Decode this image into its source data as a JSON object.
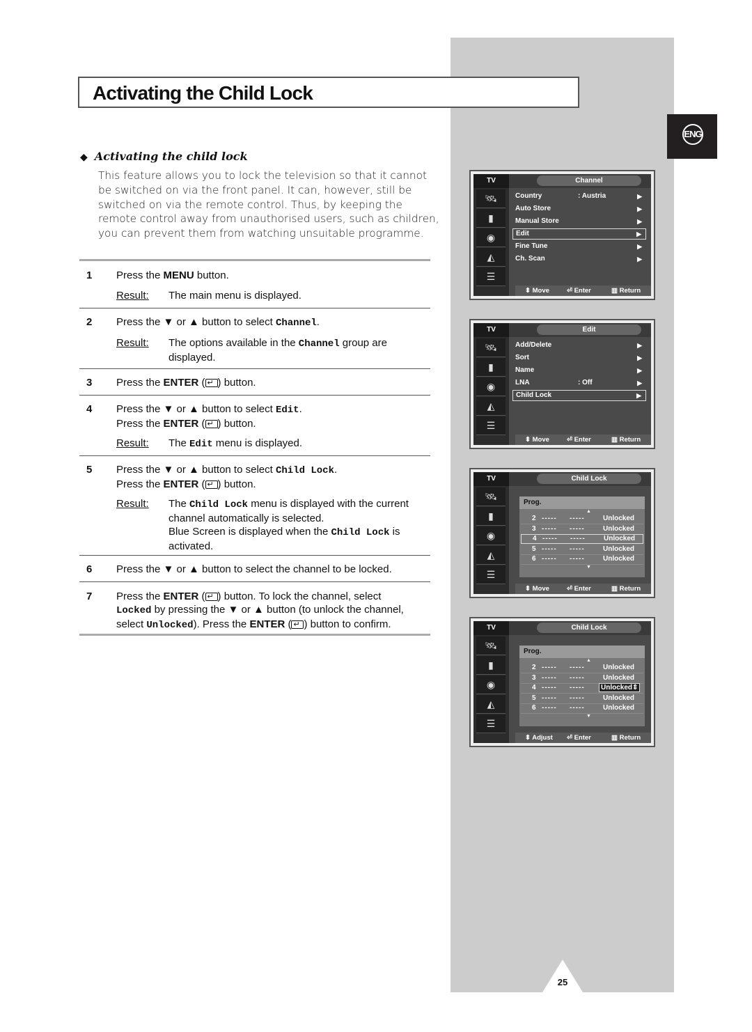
{
  "page": {
    "title": "Activating the Child Lock",
    "language_tab": "ENG",
    "page_number": "25"
  },
  "section": {
    "heading": "Activating the child lock",
    "intro": "This feature allows you to lock the television so that it cannot be switched on via the front panel. It can, however, still be switched on via the remote control. Thus, by keeping the remote control away from unauthorised users, such as children, you can prevent them from watching unsuitable programme."
  },
  "steps": [
    {
      "num": "1",
      "lines": [
        "Press the |MENU| button."
      ],
      "result_label": "Result:",
      "result": "The main menu is displayed."
    },
    {
      "num": "2",
      "lines": [
        "Press the ▼ or ▲ button to select {Channel}."
      ],
      "result_label": "Result:",
      "result": "The options available in the {Channel} group are displayed."
    },
    {
      "num": "3",
      "lines": [
        "Press the |ENTER| ([enter]) button."
      ]
    },
    {
      "num": "4",
      "lines": [
        "Press the ▼ or ▲ button to select {Edit}.",
        "Press the |ENTER| ([enter]) button."
      ],
      "result_label": "Result:",
      "result": "The {Edit} menu is displayed."
    },
    {
      "num": "5",
      "lines": [
        "Press the ▼ or ▲ button to select {Child Lock}.",
        "Press the |ENTER| ([enter]) button."
      ],
      "result_label": "Result:",
      "result": "The {Child Lock} menu is displayed with the current channel automatically is selected.\nBlue Screen is displayed when the {Child Lock} is activated."
    },
    {
      "num": "6",
      "lines": [
        "Press the ▼ or ▲ button to select the channel to be locked."
      ]
    },
    {
      "num": "7",
      "lines": [
        "Press the |ENTER| ([enter]) button. To lock the channel, select",
        "{Locked} by pressing the ▼ or ▲ button (to unlock the channel,",
        "select {Unlocked}). Press the |ENTER| ([enter]) button to confirm."
      ]
    }
  ],
  "screens": [
    {
      "tv_label": "TV",
      "header": "Channel",
      "items": [
        {
          "label": "Country",
          "value": ":  Austria",
          "arrow": "▶"
        },
        {
          "label": "Auto Store",
          "value": "",
          "arrow": "▶"
        },
        {
          "label": "Manual Store",
          "value": "",
          "arrow": "▶"
        },
        {
          "label": "Edit",
          "value": "",
          "arrow": "▶",
          "selected": true
        },
        {
          "label": "Fine Tune",
          "value": "",
          "arrow": "▶"
        },
        {
          "label": "Ch. Scan",
          "value": "",
          "arrow": "▶"
        }
      ],
      "footer": {
        "move": "Move",
        "enter": "Enter",
        "return": "Return"
      }
    },
    {
      "tv_label": "TV",
      "header": "Edit",
      "items": [
        {
          "label": "Add/Delete",
          "value": "",
          "arrow": "▶"
        },
        {
          "label": "Sort",
          "value": "",
          "arrow": "▶"
        },
        {
          "label": "Name",
          "value": "",
          "arrow": "▶"
        },
        {
          "label": "LNA",
          "value": ":  Off",
          "arrow": "▶"
        },
        {
          "label": "Child Lock",
          "value": "",
          "arrow": "▶",
          "selected": true
        }
      ],
      "footer": {
        "move": "Move",
        "enter": "Enter",
        "return": "Return"
      }
    },
    {
      "tv_label": "TV",
      "header": "Child Lock",
      "prog_header": "Prog.",
      "rows": [
        {
          "prog": "2",
          "d1": "-----",
          "d2": "-----",
          "status": "Unlocked"
        },
        {
          "prog": "3",
          "d1": "-----",
          "d2": "-----",
          "status": "Unlocked"
        },
        {
          "prog": "4",
          "d1": "-----",
          "d2": "-----",
          "status": "Unlocked",
          "selected": true
        },
        {
          "prog": "5",
          "d1": "-----",
          "d2": "-----",
          "status": "Unlocked"
        },
        {
          "prog": "6",
          "d1": "-----",
          "d2": "-----",
          "status": "Unlocked"
        }
      ],
      "footer": {
        "move": "Move",
        "enter": "Enter",
        "return": "Return"
      }
    },
    {
      "tv_label": "TV",
      "header": "Child Lock",
      "prog_header": "Prog.",
      "rows": [
        {
          "prog": "2",
          "d1": "-----",
          "d2": "-----",
          "status": "Unlocked"
        },
        {
          "prog": "3",
          "d1": "-----",
          "d2": "-----",
          "status": "Unlocked"
        },
        {
          "prog": "4",
          "d1": "-----",
          "d2": "-----",
          "status": "Unlocked",
          "adjusting": true
        },
        {
          "prog": "5",
          "d1": "-----",
          "d2": "-----",
          "status": "Unlocked"
        },
        {
          "prog": "6",
          "d1": "-----",
          "d2": "-----",
          "status": "Unlocked"
        }
      ],
      "footer": {
        "move": "Adjust",
        "enter": "Enter",
        "return": "Return"
      }
    }
  ]
}
